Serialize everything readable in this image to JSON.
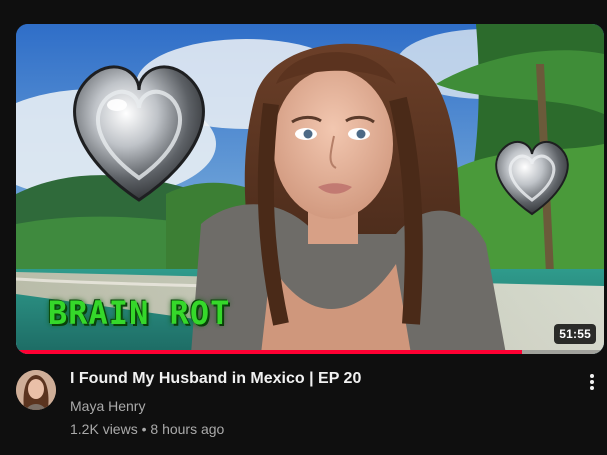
{
  "video": {
    "duration": "51:55",
    "watched_fraction": 0.86,
    "title": "I Found My Husband in Mexico | EP 20",
    "channel": "Maya Henry",
    "views": "1.2K views",
    "separator": "•",
    "age": "8 hours ago"
  },
  "thumbnail": {
    "overlay_text": "BRAIN ROT"
  },
  "icons": {
    "more": "more-vert-icon"
  },
  "colors": {
    "progress": "#ff0033",
    "background": "#0f0f0f",
    "title": "#f1f1f1",
    "secondary_text": "#aaaaaa",
    "overlay_text": "#35d82a"
  }
}
